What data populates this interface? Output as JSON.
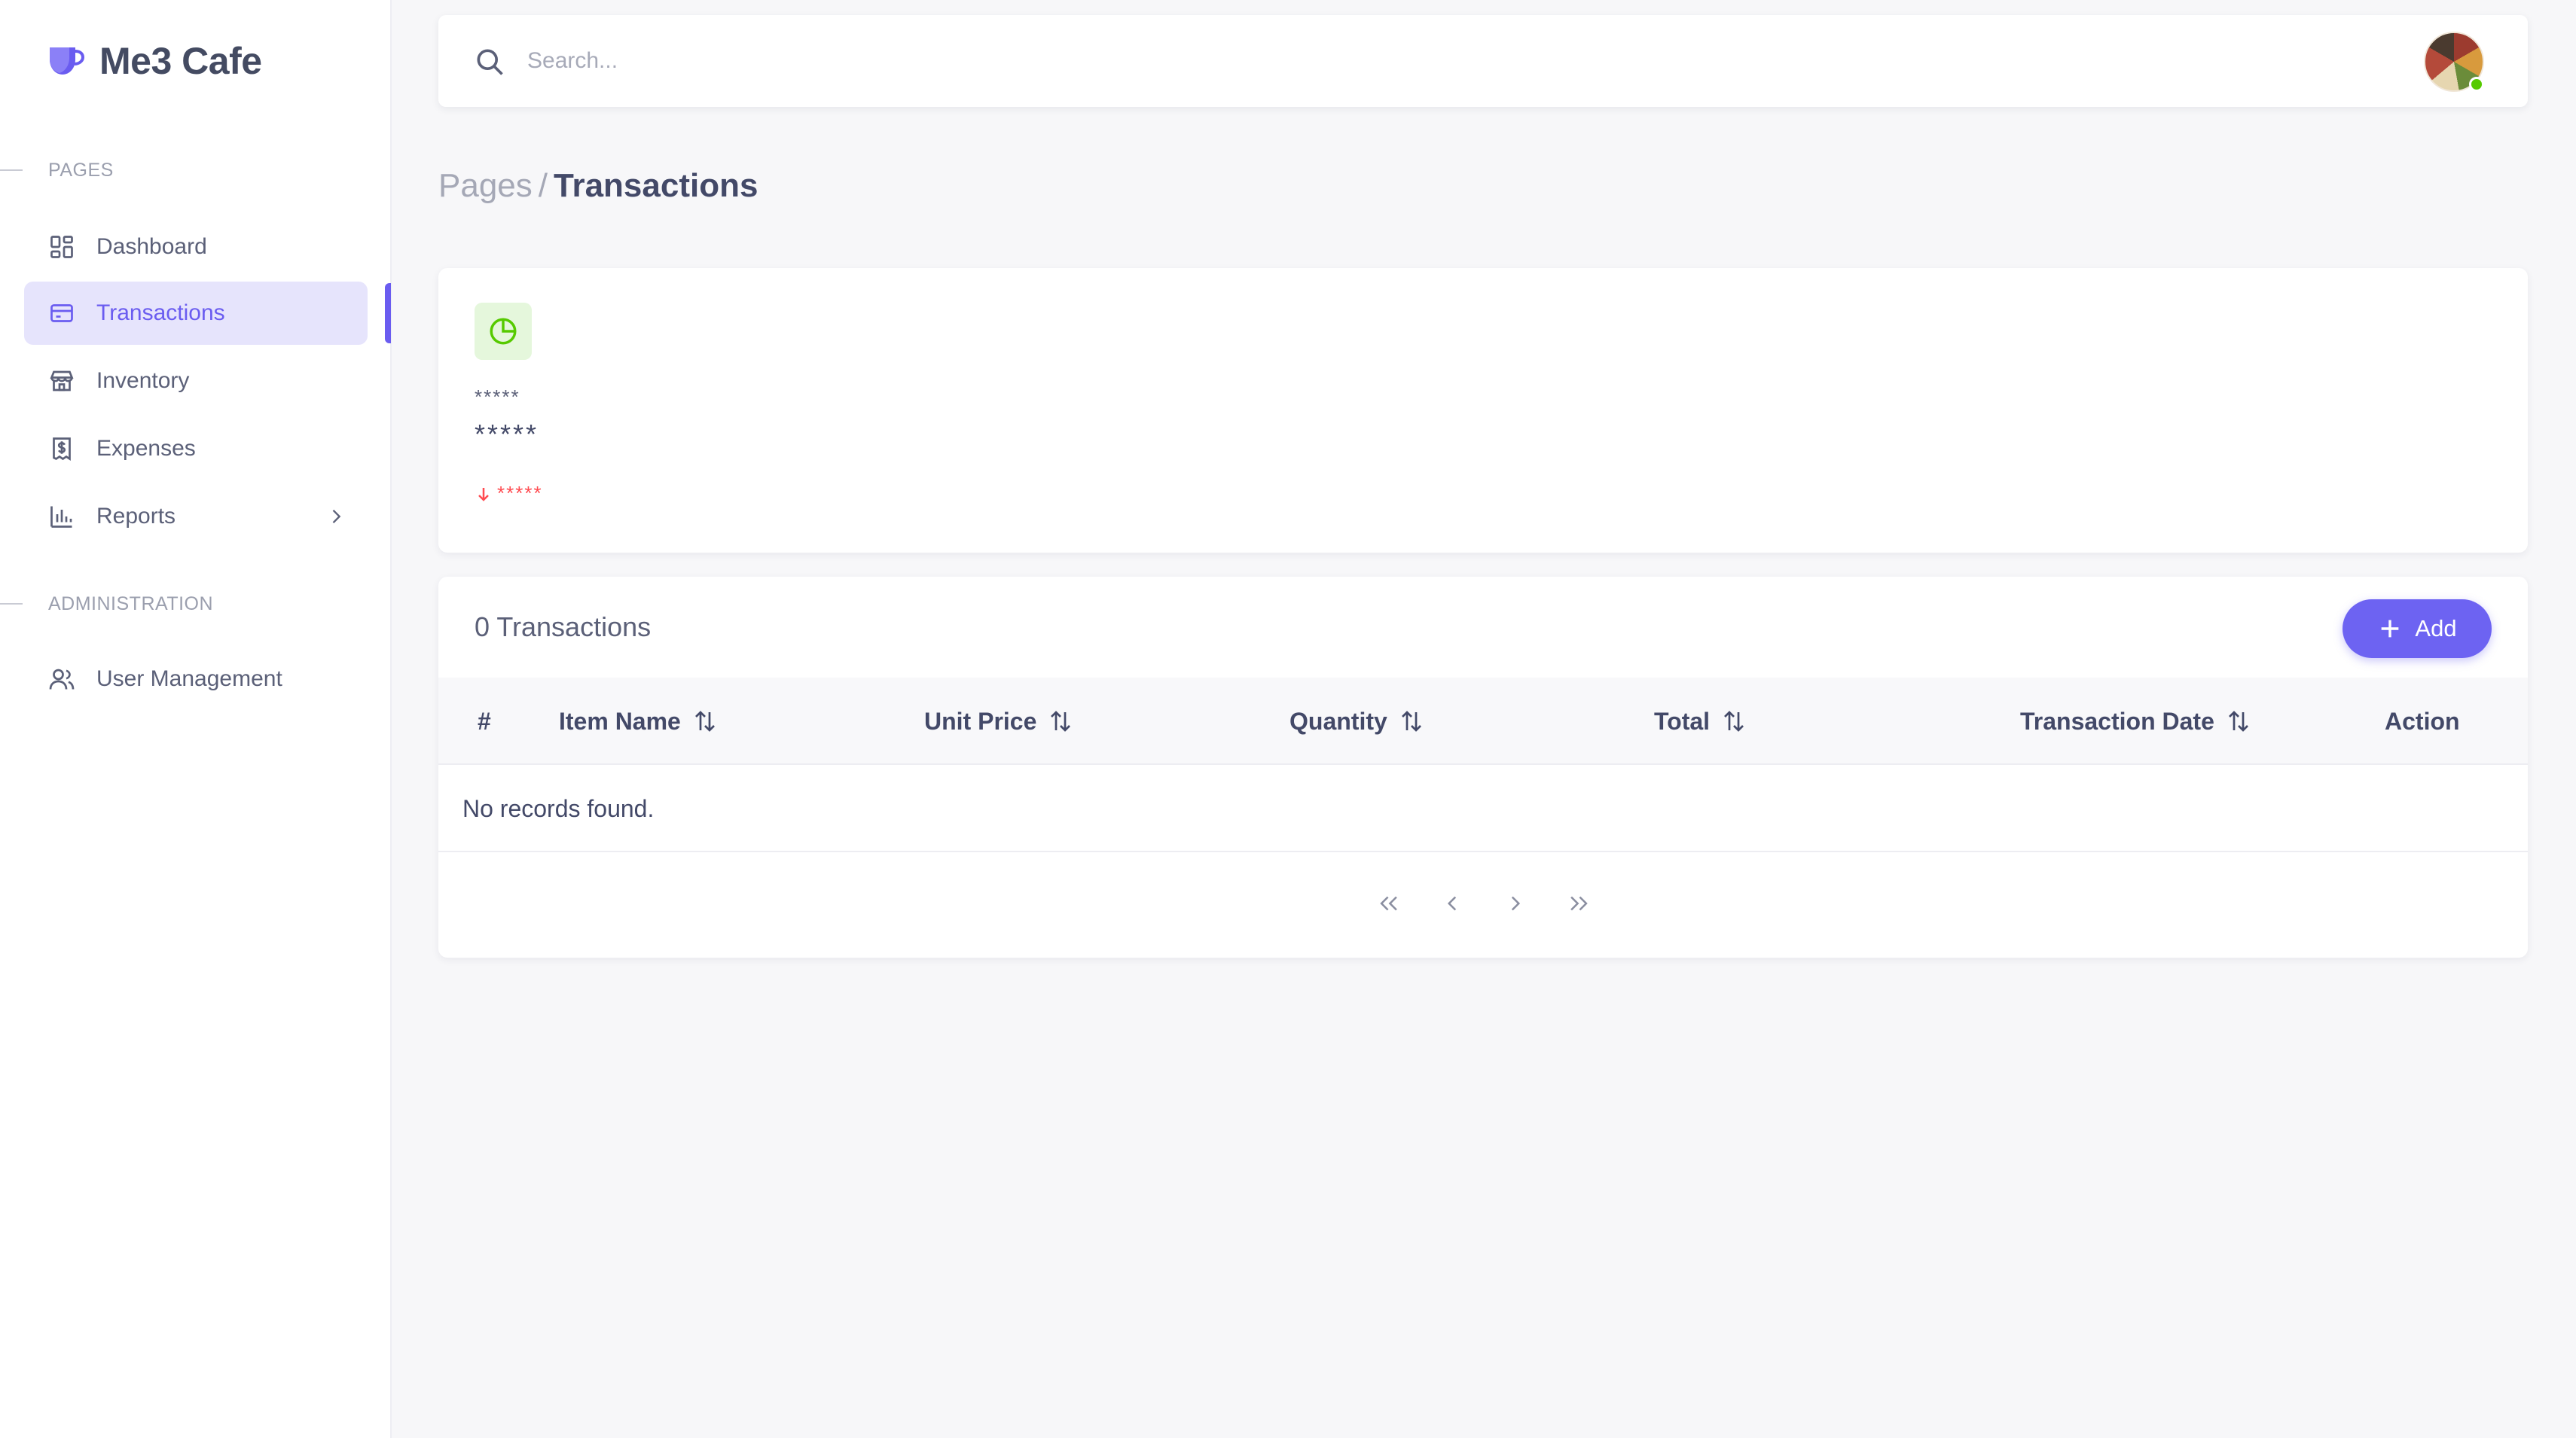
{
  "brand": {
    "name": "Me3 Cafe",
    "accent": "#6a5cf0"
  },
  "sidebar": {
    "sections": [
      {
        "label": "PAGES"
      },
      {
        "label": "ADMINISTRATION"
      }
    ],
    "items": [
      {
        "label": "Dashboard",
        "icon": "dashboard-icon"
      },
      {
        "label": "Transactions",
        "icon": "credit-card-icon",
        "active": true
      },
      {
        "label": "Inventory",
        "icon": "store-icon"
      },
      {
        "label": "Expenses",
        "icon": "receipt-dollar-icon"
      },
      {
        "label": "Reports",
        "icon": "bar-chart-icon",
        "has_submenu": true
      },
      {
        "label": "User Management",
        "icon": "users-icon"
      }
    ]
  },
  "search": {
    "placeholder": "Search..."
  },
  "breadcrumb": {
    "parent": "Pages",
    "separator": "/",
    "current": "Transactions"
  },
  "stats": {
    "icon": "pie-chart-icon",
    "label": "*****",
    "value": "*****",
    "change": "*****",
    "change_direction": "down",
    "change_color": "#ff4c51"
  },
  "table": {
    "title": "0 Transactions",
    "add_label": "Add",
    "columns": [
      "#",
      "Item Name",
      "Unit Price",
      "Quantity",
      "Total",
      "Transaction Date",
      "Action"
    ],
    "empty_message": "No records found."
  }
}
